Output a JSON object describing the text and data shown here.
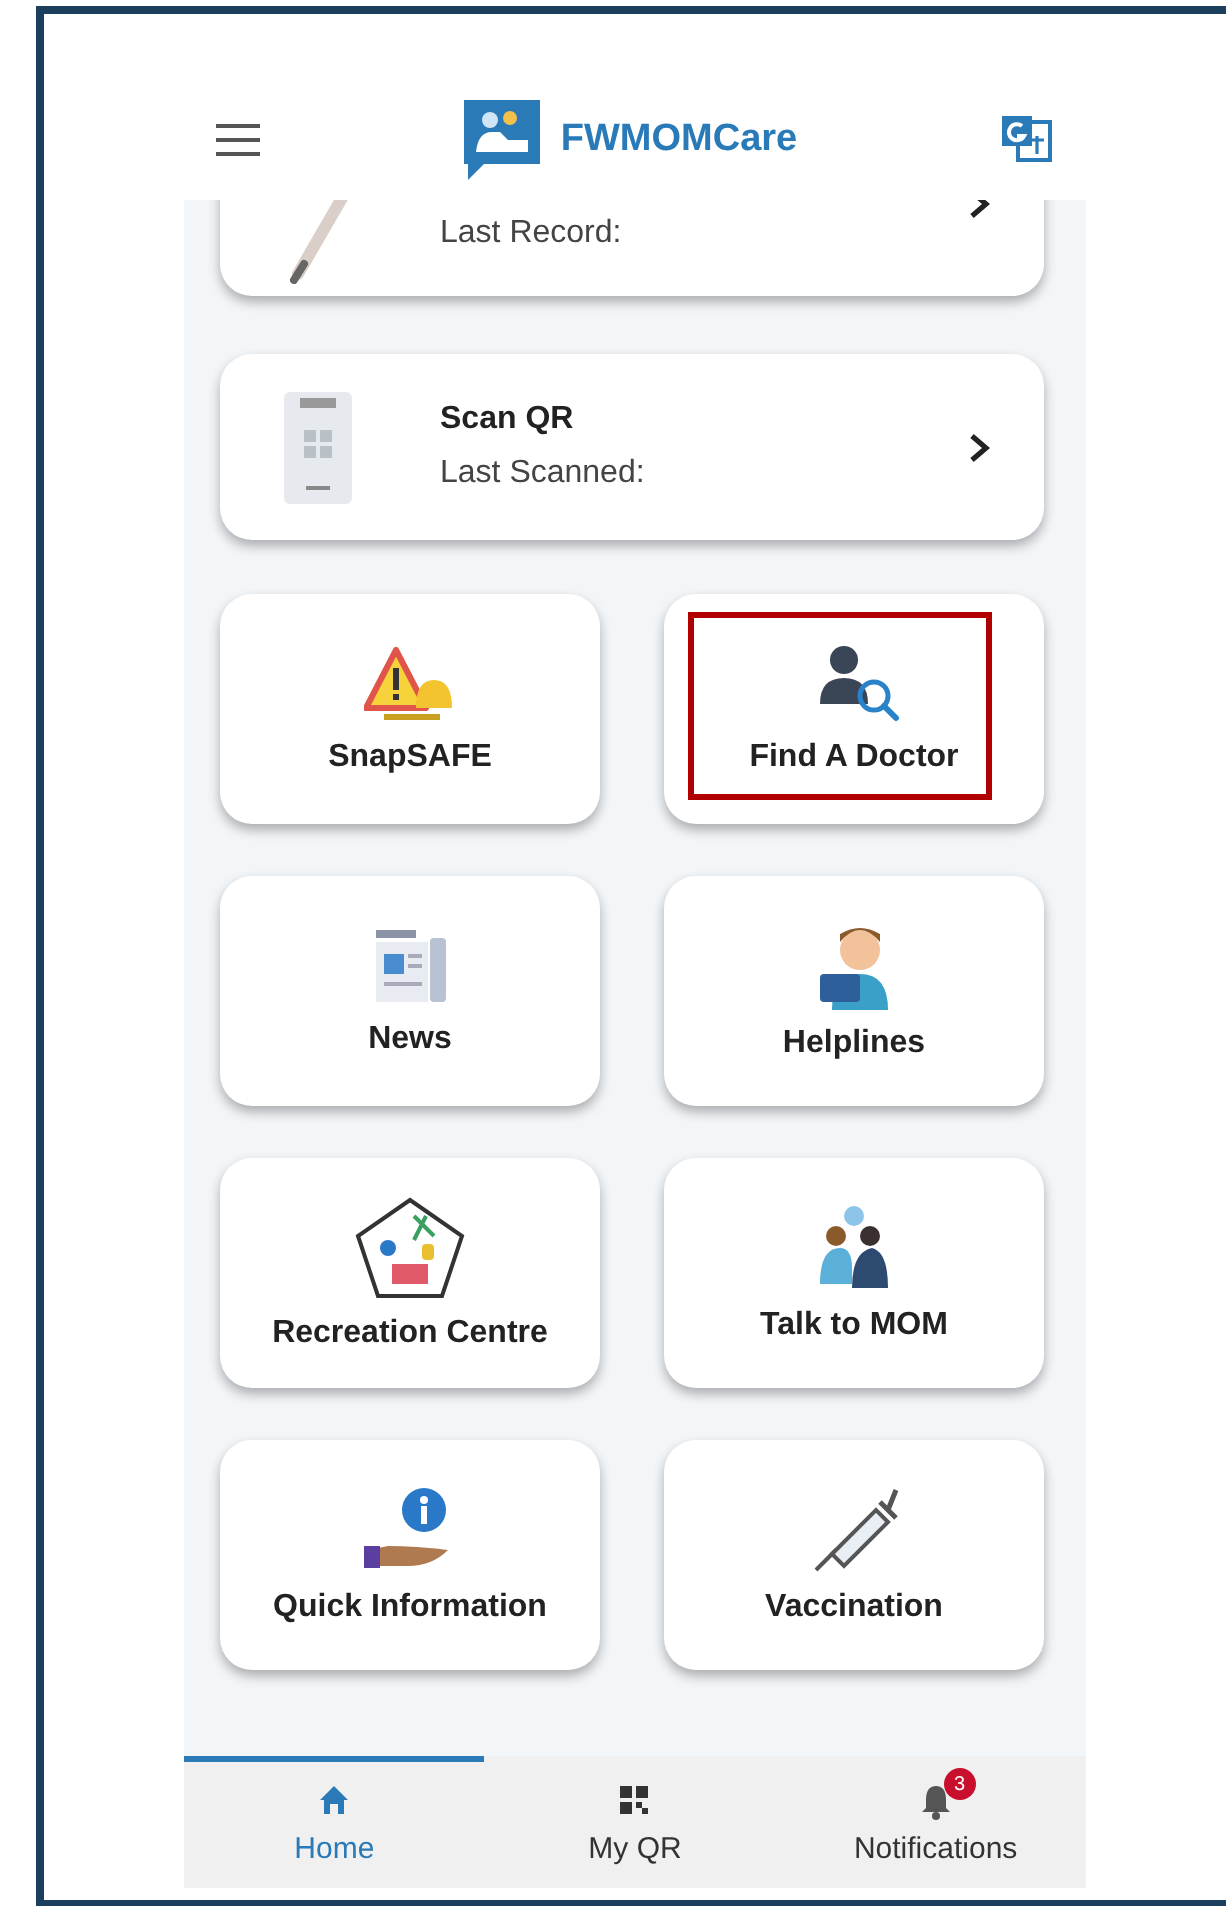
{
  "header": {
    "title": "FWMOMCare"
  },
  "record_cards": [
    {
      "subtitle": "Last Record:"
    },
    {
      "title": "Scan QR",
      "subtitle": "Last Scanned:"
    }
  ],
  "tiles": [
    {
      "label": "SnapSAFE",
      "highlighted": false
    },
    {
      "label": "Find A Doctor",
      "highlighted": true
    },
    {
      "label": "News",
      "highlighted": false
    },
    {
      "label": "Helplines",
      "highlighted": false
    },
    {
      "label": "Recreation Centre",
      "highlighted": false
    },
    {
      "label": "Talk to MOM",
      "highlighted": false
    },
    {
      "label": "Quick Information",
      "highlighted": false
    },
    {
      "label": "Vaccination",
      "highlighted": false
    }
  ],
  "bottom_nav": [
    {
      "label": "Home",
      "selected": true
    },
    {
      "label": "My QR",
      "selected": false
    },
    {
      "label": "Notifications",
      "selected": false,
      "badge": "3"
    }
  ]
}
